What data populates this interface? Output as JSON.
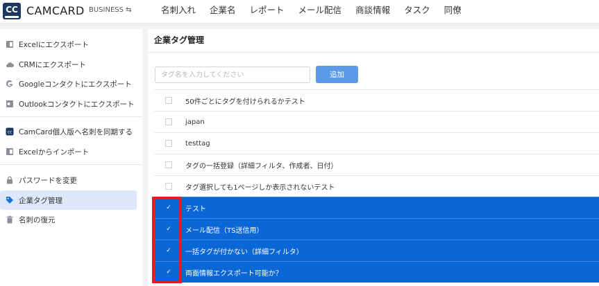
{
  "header": {
    "logo_text": "CC",
    "brand": "CAMCARD",
    "edition": "BUSINESS ⇆",
    "nav": [
      "名刺入れ",
      "企業名",
      "レポート",
      "メール配信",
      "商談情報",
      "タスク",
      "同僚"
    ]
  },
  "sidebar": {
    "items": [
      {
        "label": "Excelにエクスポート",
        "icon": "excel-icon"
      },
      {
        "label": "CRMにエクスポート",
        "icon": "cloud-icon"
      },
      {
        "label": "Googleコンタクトにエクスポート",
        "icon": "google-icon"
      },
      {
        "label": "Outlookコンタクトにエクスポート",
        "icon": "outlook-icon"
      },
      {
        "label": "CamCard個人版へ名刺を同期する",
        "icon": "camcard-icon"
      },
      {
        "label": "Excelからインポート",
        "icon": "excel-import-icon"
      },
      {
        "label": "パスワードを変更",
        "icon": "lock-icon"
      },
      {
        "label": "企業タグ管理",
        "icon": "tag-icon",
        "active": true
      },
      {
        "label": "名刺の復元",
        "icon": "trash-icon"
      }
    ]
  },
  "main": {
    "title": "企業タグ管理",
    "input_placeholder": "タグ名を入力してください",
    "add_label": "追加",
    "tags": [
      {
        "label": "50件ごとにタグを付けられるかテスト",
        "checked": false
      },
      {
        "label": "japan",
        "checked": false
      },
      {
        "label": "testtag",
        "checked": false
      },
      {
        "label": "タグの一括登録（詳細フィルタ、作成者、日付）",
        "checked": false
      },
      {
        "label": "タグ選択しても1ページしか表示されないテスト",
        "checked": false
      },
      {
        "label": "テスト",
        "checked": true
      },
      {
        "label": "メール配信（TS送信用）",
        "checked": true
      },
      {
        "label": "一括タグが付かない（詳細フィルタ）",
        "checked": true
      },
      {
        "label": "両面情報エクスポート可能か？",
        "checked": true
      }
    ],
    "check_glyph": "✓"
  },
  "colors": {
    "accent": "#0b66d6",
    "button": "#5b9ae8",
    "highlight": "#e41b23",
    "sidebar_active": "#dde8f8"
  }
}
